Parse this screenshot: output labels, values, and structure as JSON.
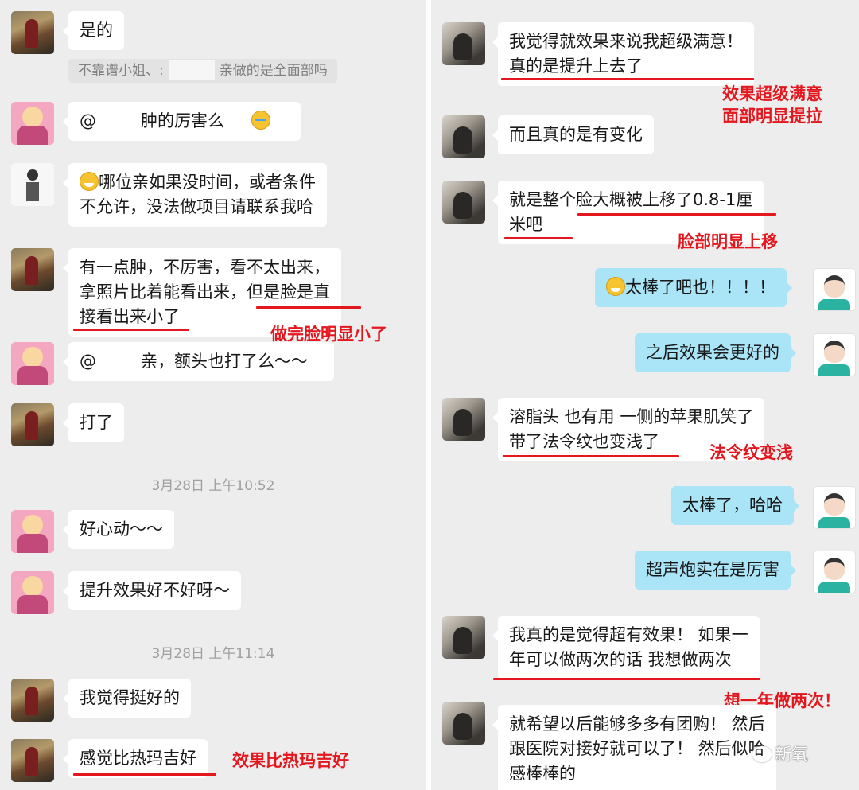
{
  "left": {
    "messages": {
      "m1": "是的",
      "m1_quote_prefix": "不靠谱小姐、:",
      "m1_quote_suffix": "亲做的是全面部吗",
      "m2_at": "@",
      "m2_text": "肿的厉害么",
      "m3_line1": "哪位亲如果没时间，或者条件",
      "m3_line2": "不允许，没法做项目请联系我哈",
      "m4_line1": "有一点肿，不厉害，看不太出来，",
      "m4_line2": "拿照片比着能看出来，但是脸是直",
      "m4_line3": "接看出来小了",
      "m5_at": "@",
      "m5_text": "亲，额头也打了么～～",
      "m6": "打了",
      "m7": "好心动～～",
      "m8": "提升效果好不好呀～",
      "m9": "我觉得挺好的",
      "m10": "感觉比热玛吉好"
    },
    "timestamps": {
      "t1": "3月28日 上午10:52",
      "t2": "3月28日 上午11:14"
    },
    "annotations": {
      "a1": "做完脸明显小了",
      "a2": "效果比热玛吉好"
    }
  },
  "right": {
    "messages": {
      "r1_line1": "我觉得就效果来说我超级满意！",
      "r1_line2": "真的是提升上去了",
      "r2": "而且真的是有变化",
      "r3_line1": "就是整个脸大概被上移了0.8-1厘",
      "r3_line2": "米吧",
      "r4": "太棒了吧也！！！！",
      "r5": "之后效果会更好的",
      "r6_line1": "溶脂头 也有用  一侧的苹果肌笑了",
      "r6_line2": "带了法令纹也变浅了",
      "r7": "太棒了，哈哈",
      "r8": "超声炮实在是厉害",
      "r9_line1": "我真的是觉得超有效果！ 如果一",
      "r9_line2": "年可以做两次的话 我想做两次",
      "r10_line1": "就希望以后能够多多有团购！ 然后",
      "r10_line2": "跟医院对接好就可以了！ 然后似哈",
      "r10_line3": "感棒棒的"
    },
    "annotations": {
      "a1_line1": "效果超级满意",
      "a1_line2": "面部明显提拉",
      "a2": "脸部明显上移",
      "a3": "法令纹变浅",
      "a4": "想一年做两次！"
    }
  },
  "watermark": "新氧",
  "colors": {
    "background": "#ededed",
    "incoming_bubble": "#ffffff",
    "outgoing_bubble": "#a9e4f7",
    "annotation_red": "#e4161e",
    "timestamp_gray": "#a0a0a0"
  },
  "icons": {
    "avatar_types": [
      "photo-avatar",
      "pink-anime-avatar",
      "cartoon-avatar",
      "cat-avatar",
      "doctor-avatar"
    ],
    "emoji": [
      "grin-emoji",
      "crying-emoji"
    ]
  }
}
